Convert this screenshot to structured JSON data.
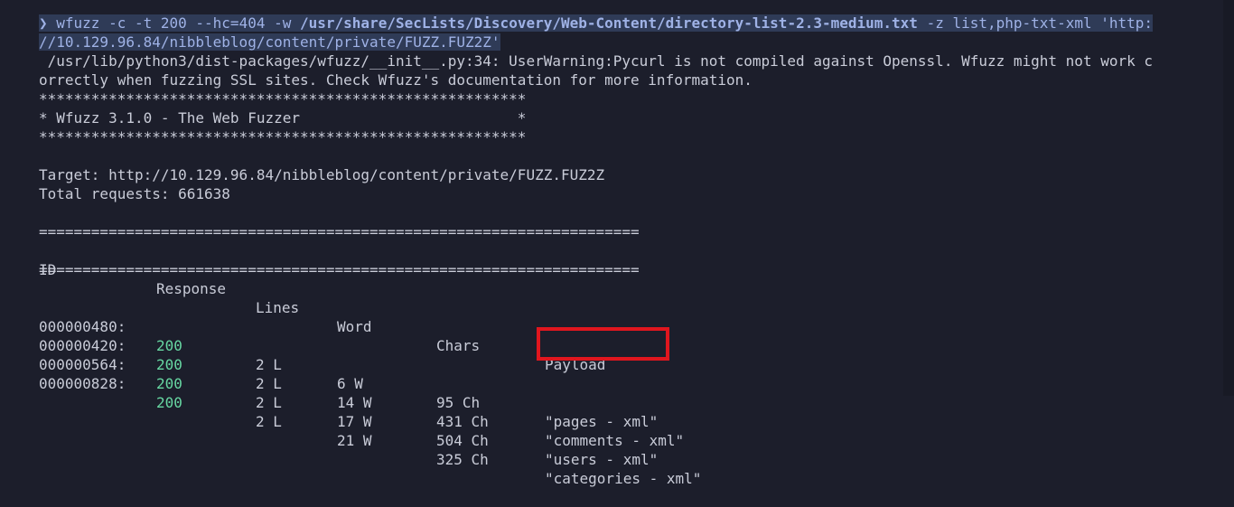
{
  "command": {
    "prompt_symbol": "❯",
    "part1": " wfuzz -c -t 200 --hc=404 -w ",
    "wordlist": "/usr/share/SecLists/Discovery/Web-Content/directory-list-2.3-medium.txt",
    "part2": " -z list,php-txt-xml 'http:",
    "line2": "//10.129.96.84/nibbleblog/content/private/FUZZ.FUZ2Z'"
  },
  "warning": {
    "line1": " /usr/lib/python3/dist-packages/wfuzz/__init__.py:34: UserWarning:Pycurl is not compiled against Openssl. Wfuzz might not work c",
    "line2": "orrectly when fuzzing SSL sites. Check Wfuzz's documentation for more information."
  },
  "banner": {
    "border": "********************************************************",
    "title": "* Wfuzz 3.1.0 - The Web Fuzzer                         *"
  },
  "target": "Target: http://10.129.96.84/nibbleblog/content/private/FUZZ.FUZ2Z",
  "total": "Total requests: 661638",
  "separator": "=====================================================================",
  "headers": {
    "id": "ID",
    "response": "Response",
    "lines": "Lines",
    "word": "Word",
    "chars": "Chars",
    "payload": "Payload"
  },
  "rows": [
    {
      "id": "000000480:",
      "response": "200",
      "lines": "2 L",
      "word": "6 W",
      "chars": "95 Ch",
      "payload": "\"pages - xml\""
    },
    {
      "id": "000000420:",
      "response": "200",
      "lines": "2 L",
      "word": "14 W",
      "chars": "431 Ch",
      "payload": "\"comments - xml\""
    },
    {
      "id": "000000564:",
      "response": "200",
      "lines": "2 L",
      "word": "17 W",
      "chars": "504 Ch",
      "payload": "\"users - xml\""
    },
    {
      "id": "000000828:",
      "response": "200",
      "lines": "2 L",
      "word": "21 W",
      "chars": "325 Ch",
      "payload": "\"categories - xml\""
    }
  ],
  "colors": {
    "background": "#1c1e2b",
    "text": "#c9ccd8",
    "status_ok": "#67d7a2",
    "highlight_box": "#e0161e",
    "selection": "#2f3b57"
  }
}
